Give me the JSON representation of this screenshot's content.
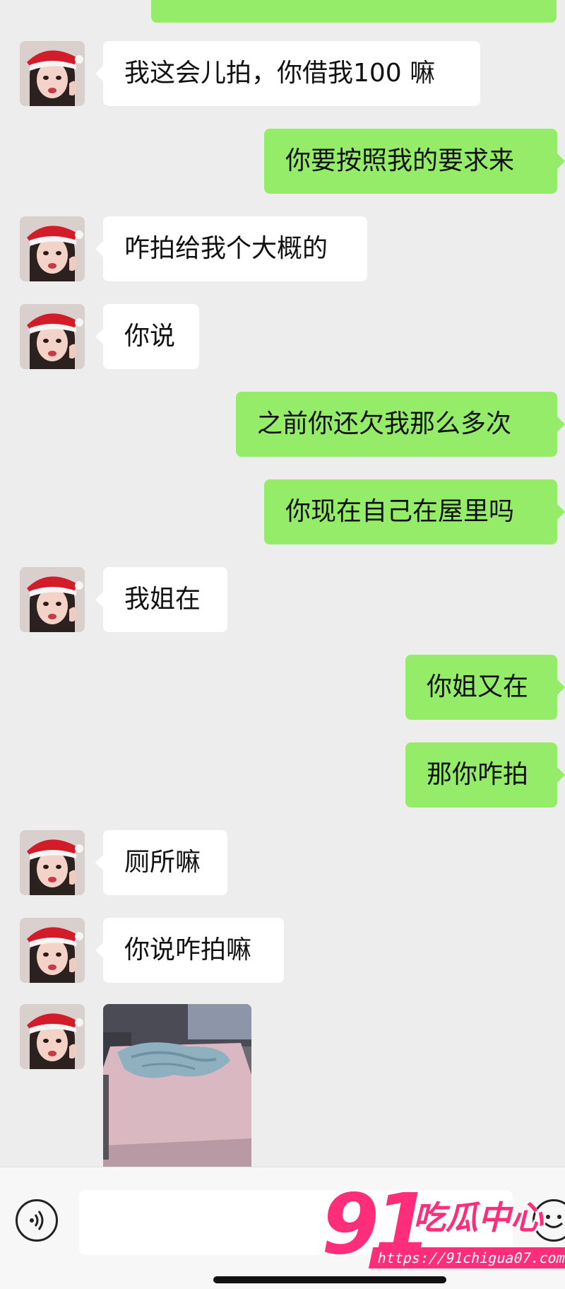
{
  "messages": [
    {
      "side": "in",
      "text": "我这会儿拍，你借我100 嘛"
    },
    {
      "side": "out",
      "text": "你要按照我的要求来"
    },
    {
      "side": "in",
      "text": "咋拍给我个大概的"
    },
    {
      "side": "in",
      "text": "你说"
    },
    {
      "side": "out",
      "text": "之前你还欠我那么多次"
    },
    {
      "side": "out",
      "text": "你现在自己在屋里吗"
    },
    {
      "side": "in",
      "text": "我姐在"
    },
    {
      "side": "out",
      "text": "你姐又在"
    },
    {
      "side": "out",
      "text": "那你咋拍"
    },
    {
      "side": "in",
      "text": "厕所嘛"
    },
    {
      "side": "in",
      "text": "你说咋拍嘛"
    }
  ],
  "image_message": {
    "side": "in",
    "content": "photo of bed with pink sheets and blue blanket"
  },
  "input_bar": {
    "voice_icon": "voice-icon",
    "emoji_icon": "emoji-icon",
    "input_value": ""
  },
  "watermark": {
    "number": "91",
    "title": "吃瓜中心",
    "url": "https://91chigua07.com"
  },
  "colors": {
    "background": "#ededed",
    "outgoing_bubble": "#95ec69",
    "incoming_bubble": "#ffffff",
    "watermark": "#ff2d7a"
  }
}
